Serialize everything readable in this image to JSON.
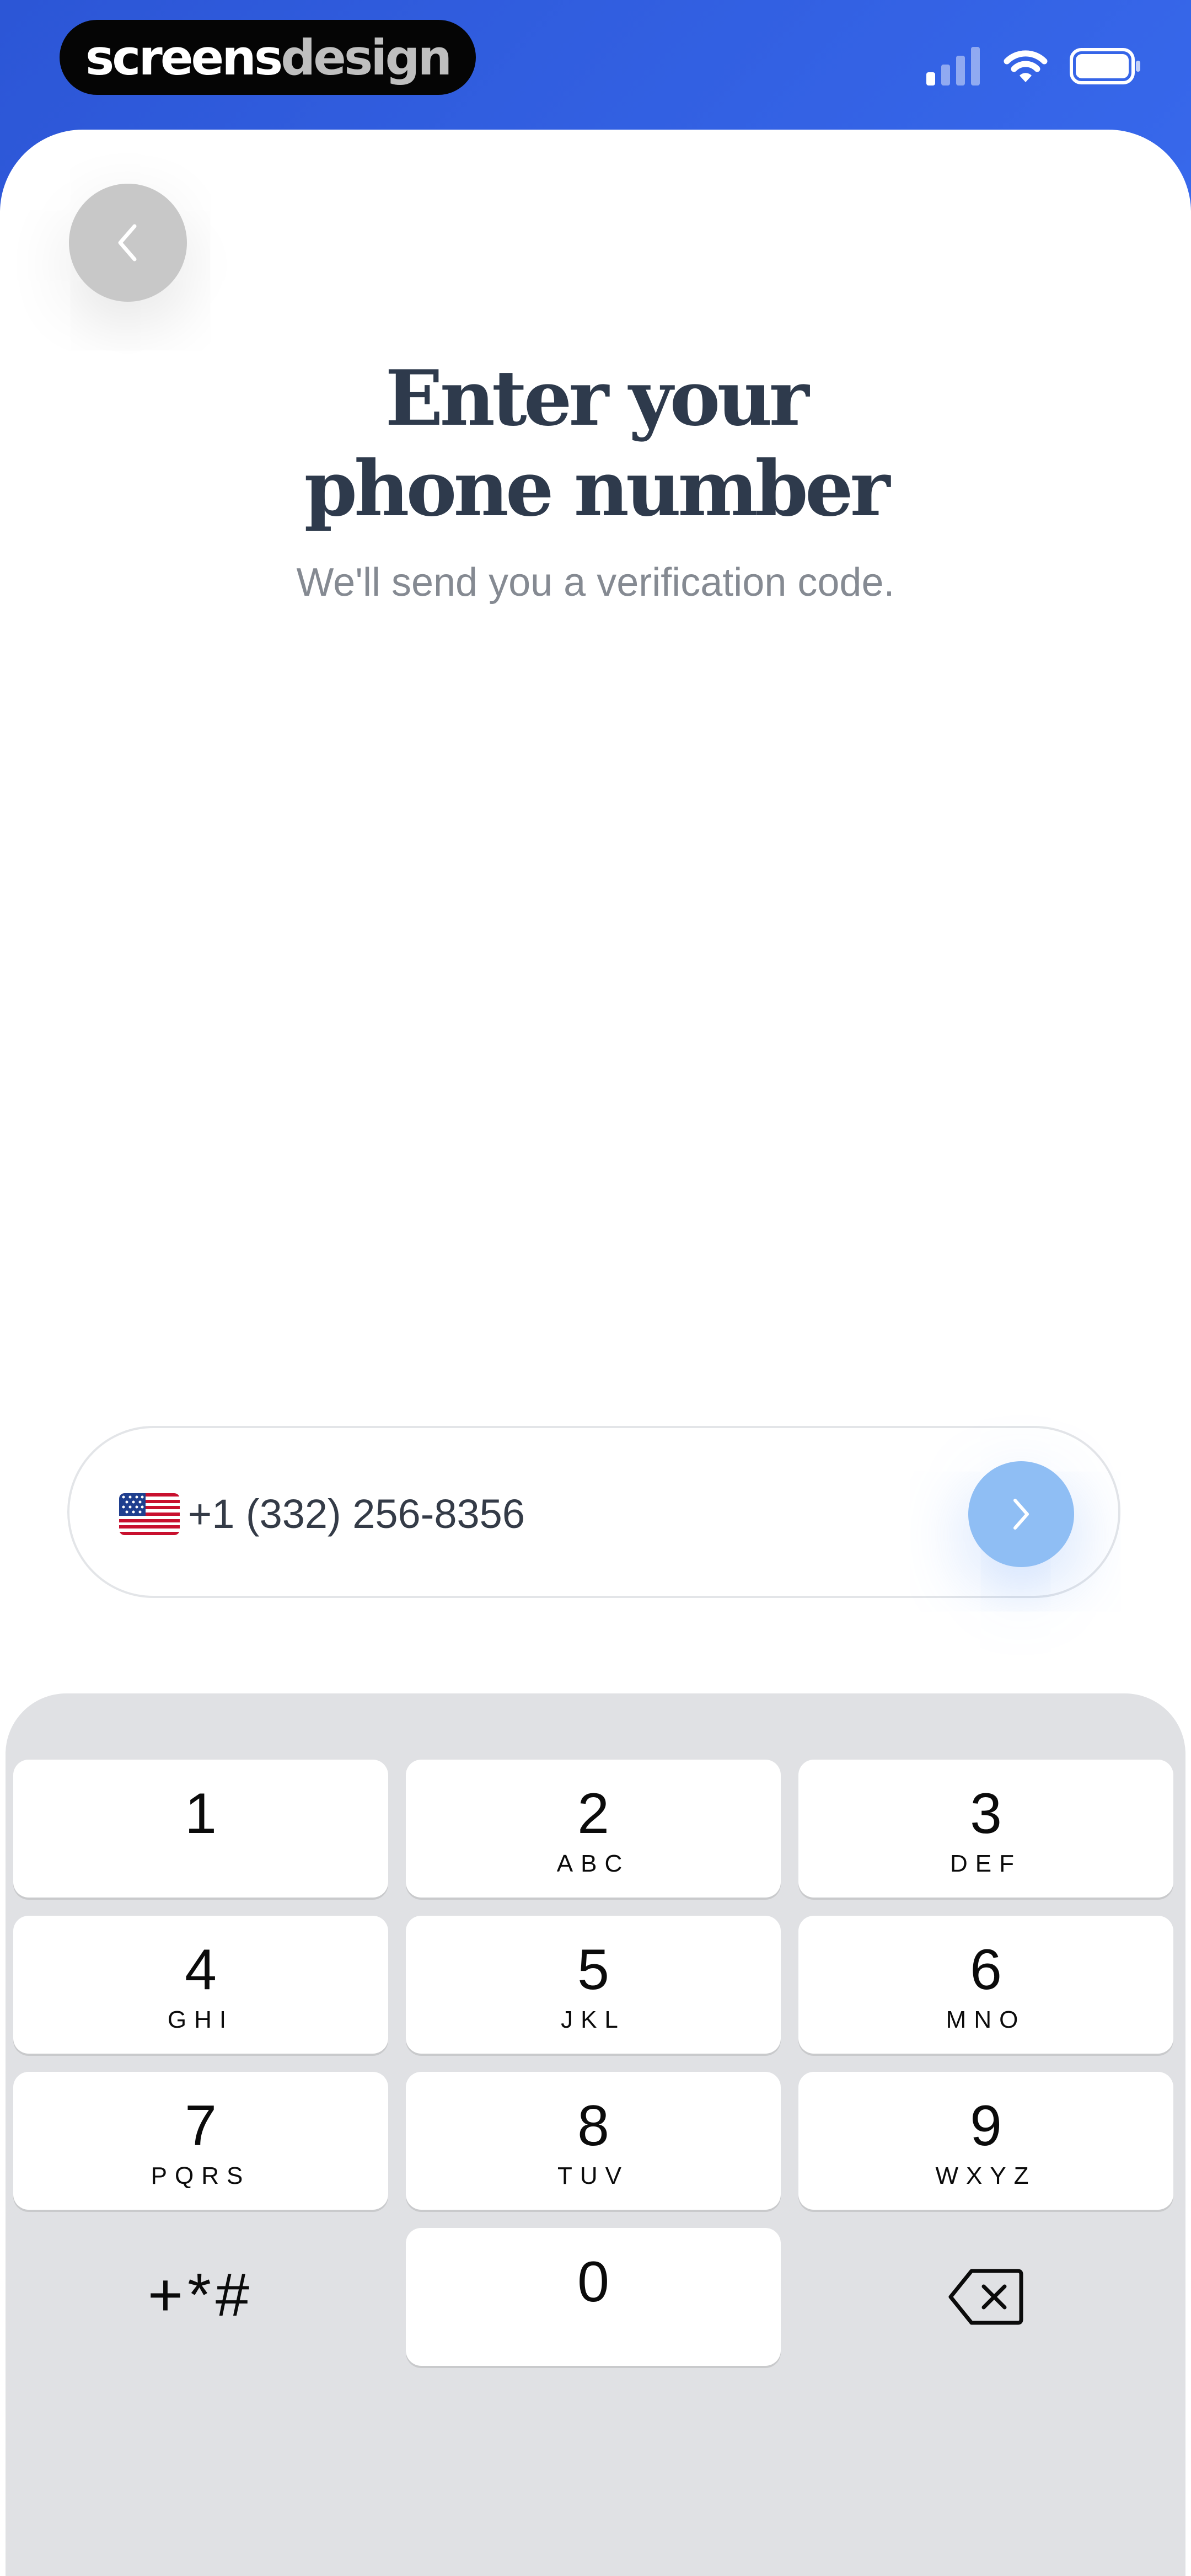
{
  "status_bar": {
    "brand_left": "screens",
    "brand_right": "design",
    "icons": [
      "cellular-signal-icon",
      "wifi-icon",
      "battery-icon"
    ]
  },
  "header": {
    "back_icon": "chevron-left-icon",
    "title_line1": "Enter your",
    "title_line2": "phone number",
    "subtitle": "We'll send you a verification code."
  },
  "phone_input": {
    "country_flag": "us-flag-icon",
    "value": "+1 (332) 256-8356",
    "submit_icon": "chevron-right-icon"
  },
  "keypad": {
    "keys": [
      {
        "digit": "1",
        "letters": ""
      },
      {
        "digit": "2",
        "letters": "ABC"
      },
      {
        "digit": "3",
        "letters": "DEF"
      },
      {
        "digit": "4",
        "letters": "GHI"
      },
      {
        "digit": "5",
        "letters": "JKL"
      },
      {
        "digit": "6",
        "letters": "MNO"
      },
      {
        "digit": "7",
        "letters": "PQRS"
      },
      {
        "digit": "8",
        "letters": "TUV"
      },
      {
        "digit": "9",
        "letters": "WXYZ"
      },
      {
        "digit": "+*#",
        "letters": ""
      },
      {
        "digit": "0",
        "letters": ""
      }
    ],
    "delete_icon": "backspace-icon"
  },
  "colors": {
    "background_blue": "#3a6cf0",
    "title_text": "#2e3a4c",
    "subtitle_text": "#858a92",
    "submit_button": "#8fbef4",
    "keyboard_bg": "#e0e1e4"
  }
}
